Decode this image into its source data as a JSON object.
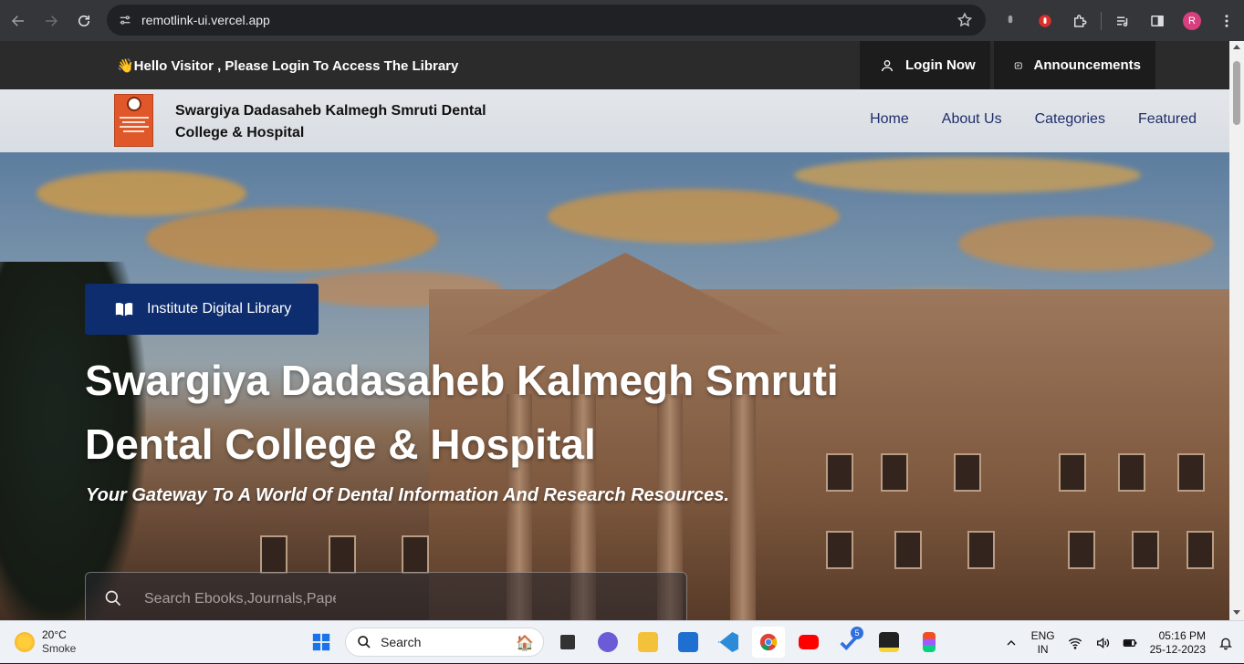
{
  "browser": {
    "url": "remotlink-ui.vercel.app",
    "profile_initial": "R"
  },
  "topbar": {
    "greeting": "👋Hello Visitor , Please Login To Access The Library",
    "login_label": "Login Now",
    "announcements_label": "Announcements"
  },
  "header": {
    "college_name": "Swargiya Dadasaheb Kalmegh Smruti Dental College & Hospital",
    "nav": [
      "Home",
      "About Us",
      "Categories",
      "Featured"
    ]
  },
  "hero": {
    "badge_label": "Institute Digital Library",
    "title": "Swargiya Dadasaheb Kalmegh Smruti Dental College & Hospital",
    "tagline": "Your Gateway To A World Of Dental Information And Research Resources.",
    "search_placeholder": "Search Ebooks,Journals,Papers"
  },
  "taskbar": {
    "weather_temp": "20°C",
    "weather_desc": "Smoke",
    "search_label": "Search",
    "todo_badge": "5",
    "lang_line1": "ENG",
    "lang_line2": "IN",
    "time": "05:16 PM",
    "date": "25-12-2023"
  }
}
